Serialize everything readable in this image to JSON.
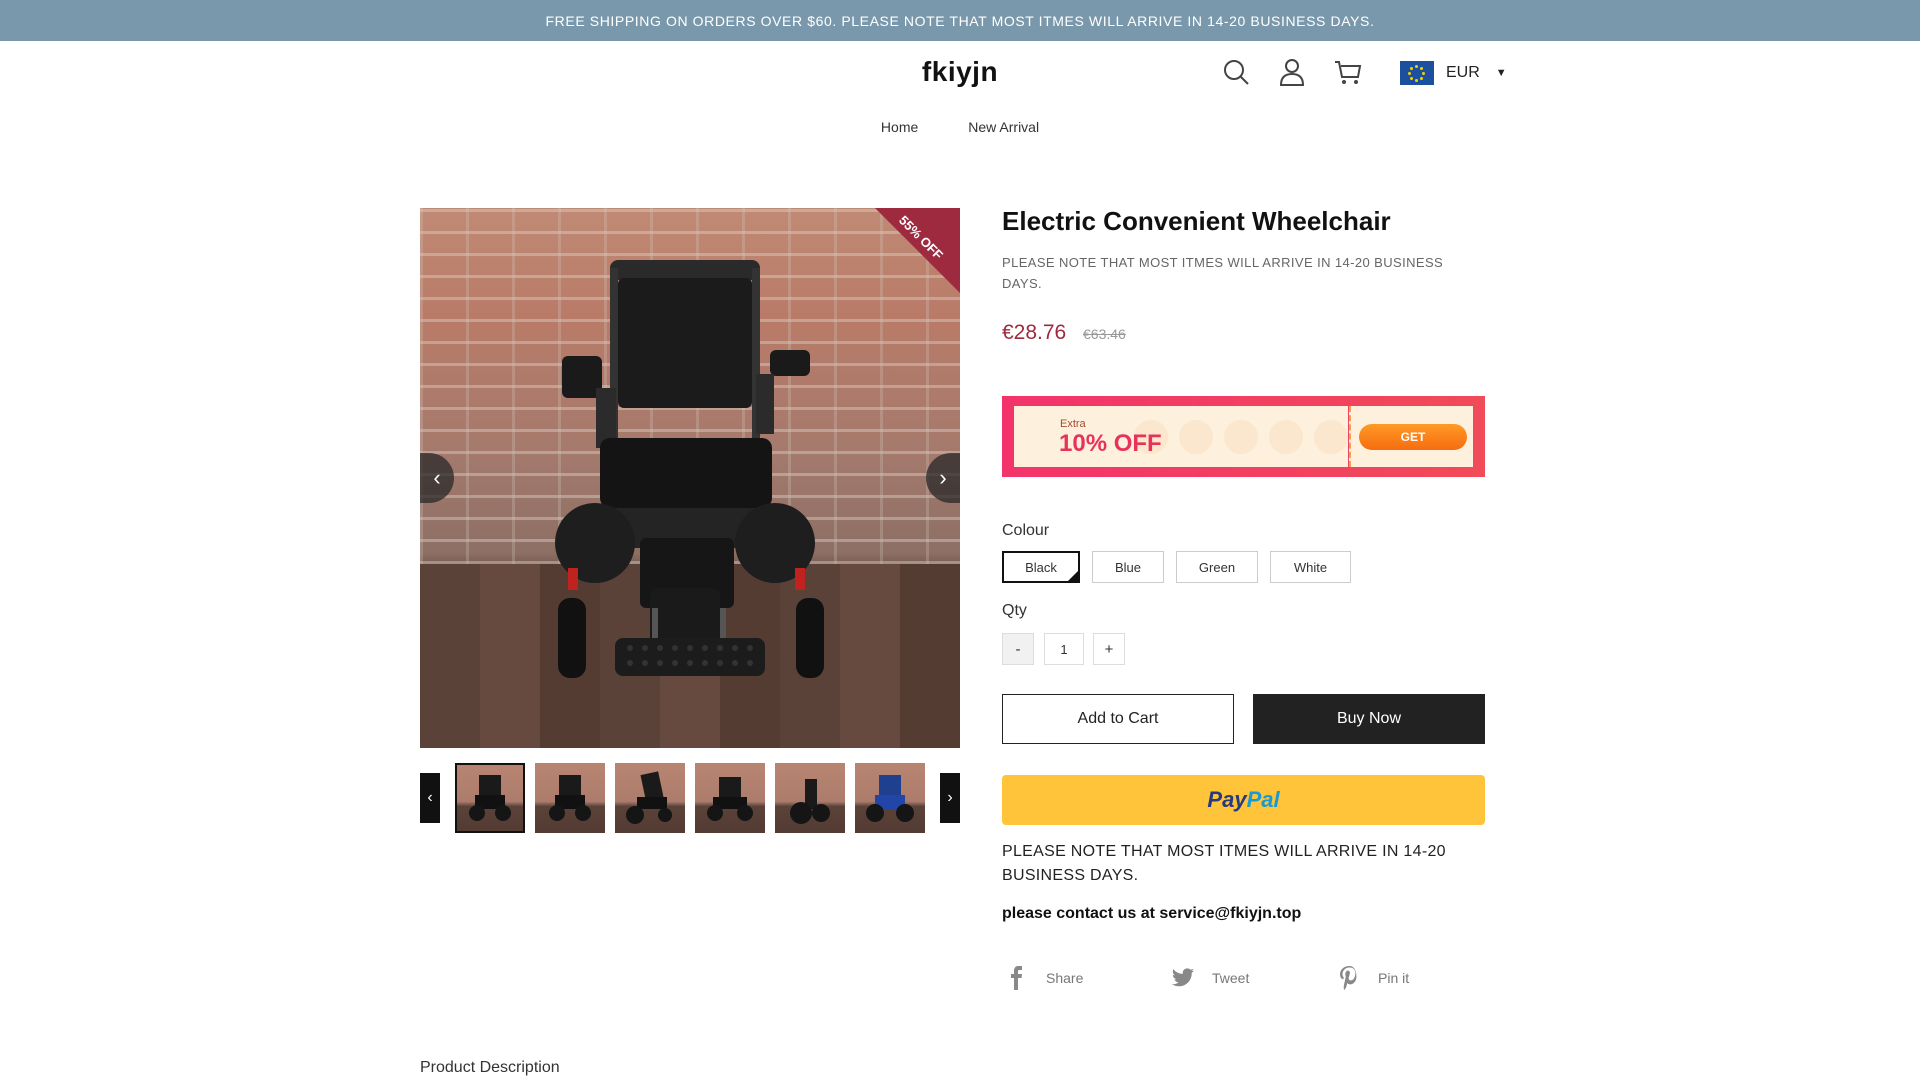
{
  "announcement": "FREE SHIPPING ON ORDERS OVER $60. PLEASE NOTE THAT MOST ITMES WILL ARRIVE IN 14-20 BUSINESS DAYS.",
  "header": {
    "logo": "fkiyjn",
    "icons": [
      "search-icon",
      "user-icon",
      "cart-icon"
    ],
    "currency": "EUR"
  },
  "nav": {
    "items": [
      "Home",
      "New Arrival"
    ]
  },
  "gallery": {
    "badge": "55% OFF",
    "prev_label": "‹",
    "next_label": "›",
    "thumbnail_count": 6
  },
  "product": {
    "title": "Electric Convenient Wheelchair",
    "subnote": "PLEASE NOTE THAT MOST ITMES WILL ARRIVE IN 14-20 BUSINESS DAYS.",
    "price": "€28.76",
    "compare_price": "€63.46"
  },
  "coupon": {
    "extra": "Extra",
    "off": "10% OFF",
    "button": "GET"
  },
  "options": {
    "colour_label": "Colour",
    "colours": [
      "Black",
      "Blue",
      "Green",
      "White"
    ],
    "selected": "Black",
    "qty_label": "Qty",
    "qty_value": "1",
    "minus": "-",
    "plus": "+"
  },
  "actions": {
    "add_to_cart": "Add to Cart",
    "buy_now": "Buy Now",
    "paypal_a": "Pay",
    "paypal_b": "Pal"
  },
  "note": "PLEASE NOTE THAT MOST ITMES WILL ARRIVE IN 14-20 BUSINESS DAYS.",
  "contact": "please contact us at service@fkiyjn.top",
  "share": {
    "facebook": "Share",
    "twitter": "Tweet",
    "pinterest": "Pin it"
  },
  "section": {
    "product_description": "Product Description"
  },
  "colors": {
    "announcement_bg": "#7a98ab",
    "price": "#9e2a40",
    "coupon": "#f2346b",
    "paypal": "#ffc439"
  }
}
